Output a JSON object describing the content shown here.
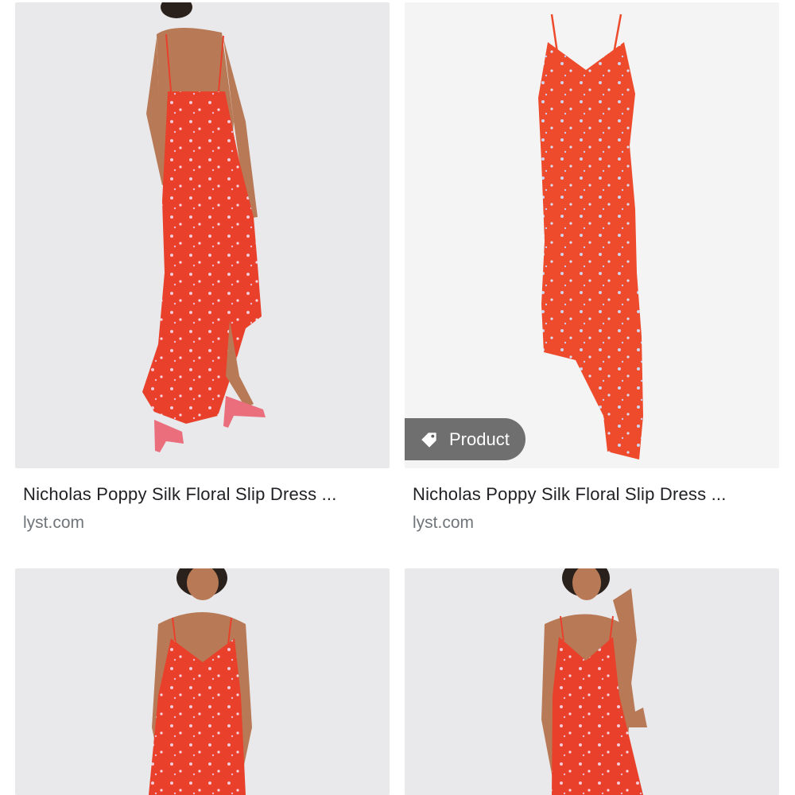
{
  "results": [
    {
      "title": "Nicholas Poppy Silk Floral Slip Dress ...",
      "source": "lyst.com",
      "image": "red-floral-slip-dress-back-view",
      "badge": null
    },
    {
      "title": "Nicholas Poppy Silk Floral Slip Dress ...",
      "source": "lyst.com",
      "image": "red-floral-slip-dress-front-product",
      "badge": "Product"
    },
    {
      "title": "",
      "source": "",
      "image": "red-floral-slip-dress-front-model",
      "badge": null
    },
    {
      "title": "",
      "source": "",
      "image": "red-floral-slip-dress-front-model-pose",
      "badge": null
    }
  ],
  "colors": {
    "dress": "#e8402a",
    "background": "#e9e8ea",
    "badge_bg": "#606060",
    "title_text": "#202124",
    "source_text": "#70757a"
  }
}
